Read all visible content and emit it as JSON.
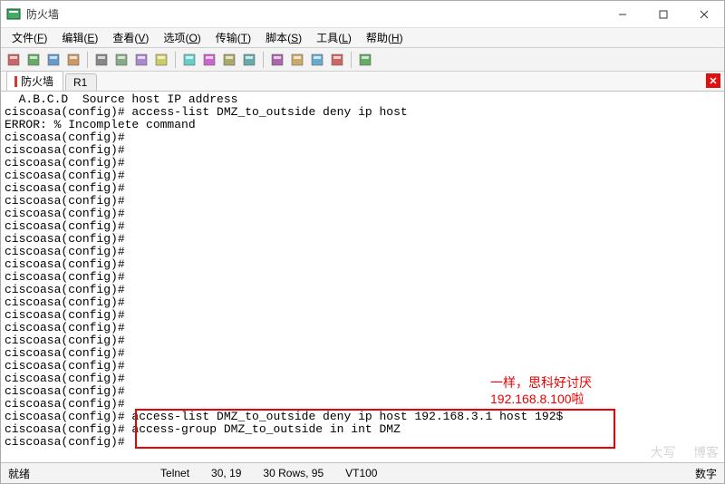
{
  "window": {
    "title": "防火墙"
  },
  "menus": {
    "file": {
      "label": "文件",
      "accel": "F"
    },
    "edit": {
      "label": "编辑",
      "accel": "E"
    },
    "view": {
      "label": "查看",
      "accel": "V"
    },
    "options": {
      "label": "选项",
      "accel": "O"
    },
    "transfer": {
      "label": "传输",
      "accel": "T"
    },
    "script": {
      "label": "脚本",
      "accel": "S"
    },
    "tools": {
      "label": "工具",
      "accel": "L"
    },
    "help": {
      "label": "帮助",
      "accel": "H"
    }
  },
  "tabs": {
    "t1": "防火墙",
    "t2": "R1"
  },
  "terminal_lines": [
    "  A.B.C.D  Source host IP address",
    "ciscoasa(config)# access-list DMZ_to_outside deny ip host",
    "ERROR: % Incomplete command",
    "ciscoasa(config)#",
    "ciscoasa(config)#",
    "ciscoasa(config)#",
    "ciscoasa(config)#",
    "ciscoasa(config)#",
    "ciscoasa(config)#",
    "ciscoasa(config)#",
    "ciscoasa(config)#",
    "ciscoasa(config)#",
    "ciscoasa(config)#",
    "ciscoasa(config)#",
    "ciscoasa(config)#",
    "ciscoasa(config)#",
    "ciscoasa(config)#",
    "ciscoasa(config)#",
    "ciscoasa(config)#",
    "ciscoasa(config)#",
    "ciscoasa(config)#",
    "ciscoasa(config)#",
    "ciscoasa(config)#",
    "ciscoasa(config)#",
    "ciscoasa(config)#",
    "ciscoasa(config)# access-list DMZ_to_outside deny ip host 192.168.3.1 host 192$",
    "ciscoasa(config)# access-group DMZ_to_outside in int DMZ",
    "ciscoasa(config)#"
  ],
  "annotation": {
    "line1": "一样，思科好讨厌",
    "line2": "192.168.8.100啦"
  },
  "status": {
    "ready": "就绪",
    "proto": "Telnet",
    "pos": "30, 19",
    "rows": "30 Rows, 95",
    "term": "VT100",
    "numlock": "数字"
  },
  "toolbar_icons": [
    "doc-new-icon",
    "connect-icon",
    "quick-connect-icon",
    "disconnect-icon",
    "sep",
    "cut-icon",
    "copy-icon",
    "paste-icon",
    "find-icon",
    "sep",
    "print-icon",
    "options-icon",
    "tile-icon",
    "session-icon",
    "sep",
    "script-run-icon",
    "script-cancel-icon",
    "key-icon",
    "info-icon",
    "sep",
    "transfer-icon"
  ]
}
